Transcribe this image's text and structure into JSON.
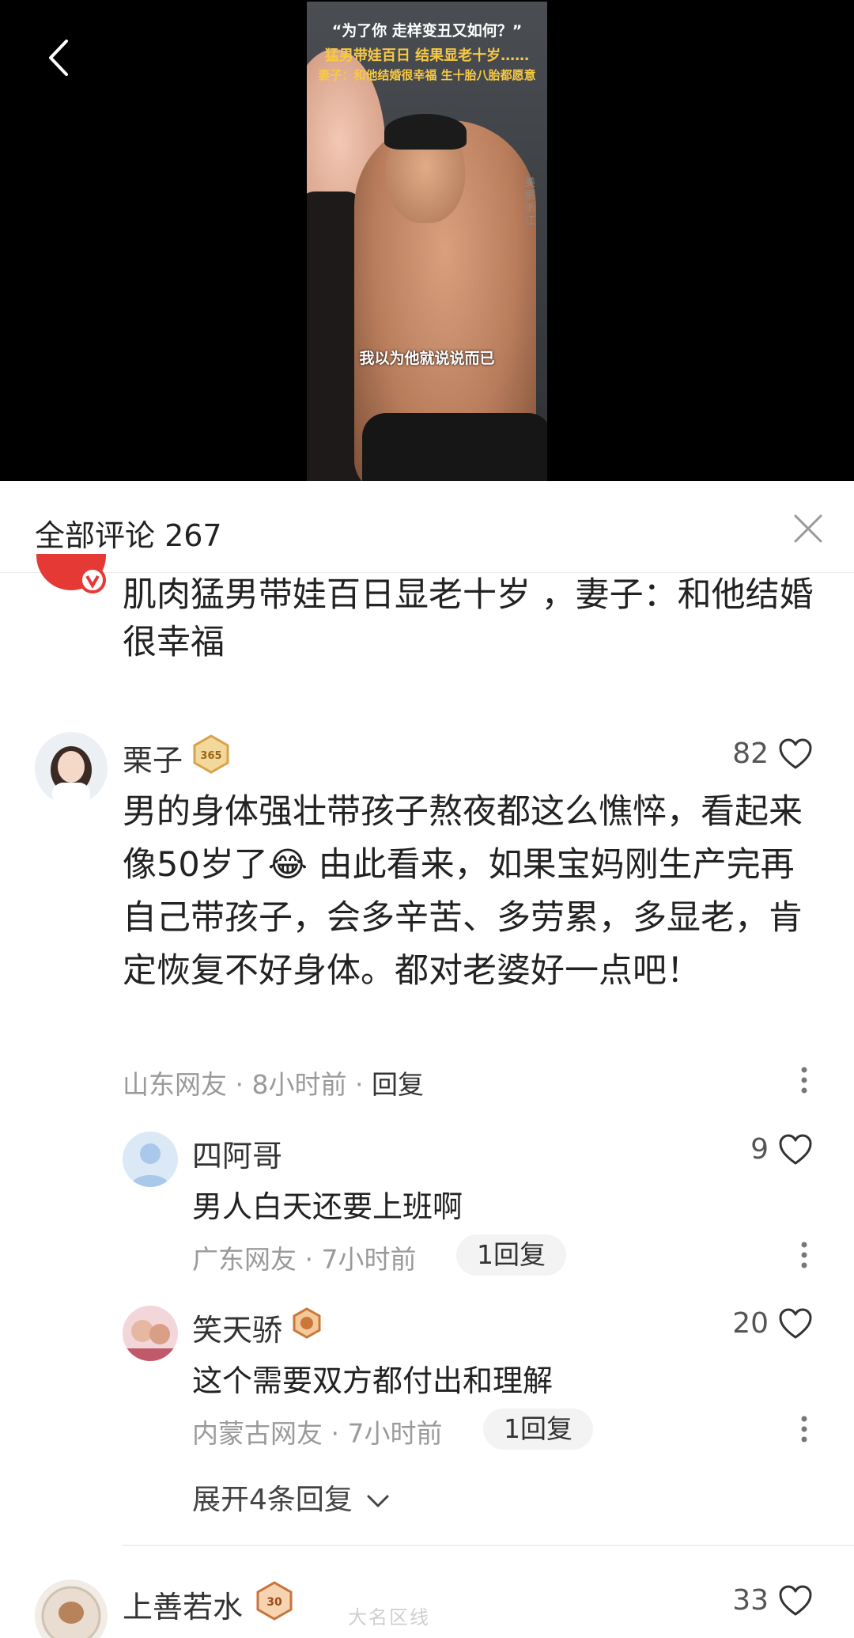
{
  "video": {
    "caption_line1": "“为了你 走样变丑又如何？”",
    "caption_line2": "猛男带娃百日 结果显老十岁……",
    "caption_line3": "妻子：和他结婚很幸福 生十胎八胎都愿意",
    "subtitle": "我以为他就说说而已",
    "watermark": "美丽浙江"
  },
  "comments_header": {
    "title": "全部评论 267"
  },
  "article": {
    "title": "肌肉猛男带娃百日显老十岁 ，妻子：和他结婚很幸福"
  },
  "comments": [
    {
      "user": "栗子",
      "badge_text": "365",
      "likes": "82",
      "text": "男的身体强壮带孩子熬夜都这么憔悴，看起来像50岁了😂 由此看来，如果宝妈刚生产完再自己带孩子，会多辛苦、多劳累，多显老，肯定恢复不好身体。都对老婆好一点吧！",
      "location": "山东网友",
      "time": "8小时前",
      "reply_label": "回复"
    },
    {
      "user": "四阿哥",
      "likes": "9",
      "text": "男人白天还要上班啊",
      "location": "广东网友",
      "time": "7小时前",
      "reply_label": "1回复"
    },
    {
      "user": "笑天骄",
      "likes": "20",
      "text": "这个需要双方都付出和理解",
      "location": "内蒙古网友",
      "time": "7小时前",
      "reply_label": "1回复"
    },
    {
      "user": "上善若水",
      "badge_text": "30",
      "likes": "33"
    }
  ],
  "expand_label": "展开4条回复",
  "meta_separator": "·",
  "site_watermark": "大名区线",
  "icons": {
    "back": "back-arrow-icon",
    "close": "close-icon",
    "like": "heart-icon",
    "more": "more-vertical-icon",
    "expand": "chevron-down-icon"
  },
  "colors": {
    "background": "#ffffff",
    "video_bg": "#000000",
    "badge_gold": "#d8a24a",
    "muted_text": "#9a9a9a"
  }
}
